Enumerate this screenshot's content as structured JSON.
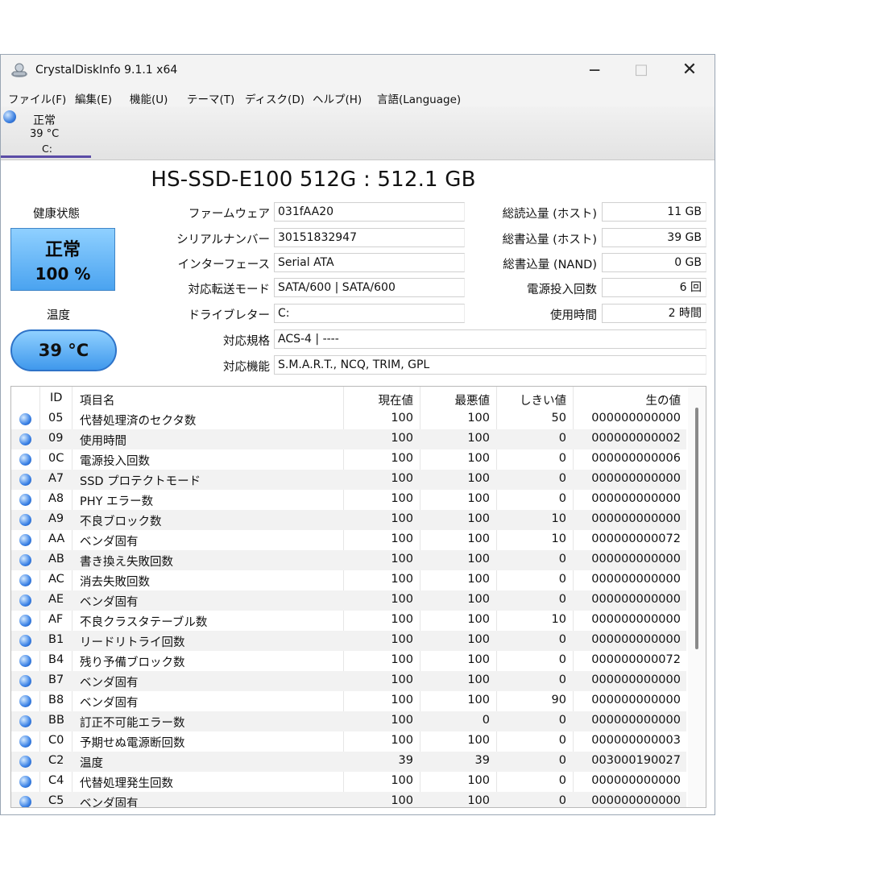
{
  "window": {
    "title": "CrystalDiskInfo 9.1.1 x64",
    "minimize_glyph": "─",
    "maximize_glyph": "□",
    "close_glyph": "✕"
  },
  "menu": [
    "ファイル(F)",
    "編集(E)",
    "機能(U)",
    "テーマ(T)",
    "ディスク(D)",
    "ヘルプ(H)",
    "言語(Language)"
  ],
  "drive_tab": {
    "status": "正常",
    "temperature": "39 °C",
    "letter": "C:"
  },
  "drive_title": "HS-SSD-E100 512G : 512.1 GB",
  "health": {
    "label": "健康状態",
    "status": "正常",
    "percent": "100 %"
  },
  "temperature": {
    "label": "温度",
    "value": "39 °C"
  },
  "fields": {
    "firmware": {
      "label": "ファームウェア",
      "value": "031fAA20"
    },
    "serial": {
      "label": "シリアルナンバー",
      "value": "30151832947"
    },
    "interface": {
      "label": "インターフェース",
      "value": "Serial ATA"
    },
    "transfer_mode": {
      "label": "対応転送モード",
      "value": "SATA/600 | SATA/600"
    },
    "drive_letter": {
      "label": "ドライブレター",
      "value": "C:"
    },
    "standard": {
      "label": "対応規格",
      "value": "ACS-4 | ----"
    },
    "features": {
      "label": "対応機能",
      "value": "S.M.A.R.T., NCQ, TRIM, GPL"
    },
    "host_reads": {
      "label": "総読込量 (ホスト)",
      "value": "11 GB"
    },
    "host_writes": {
      "label": "総書込量 (ホスト)",
      "value": "39 GB"
    },
    "nand_writes": {
      "label": "総書込量 (NAND)",
      "value": "0 GB"
    },
    "power_on_count": {
      "label": "電源投入回数",
      "value": "6 回"
    },
    "power_on_hours": {
      "label": "使用時間",
      "value": "2 時間"
    }
  },
  "smart": {
    "headers": {
      "id": "ID",
      "name": "項目名",
      "current": "現在値",
      "worst": "最悪値",
      "threshold": "しきい値",
      "raw": "生の値"
    },
    "rows": [
      {
        "id": "05",
        "name": "代替処理済のセクタ数",
        "current": "100",
        "worst": "100",
        "threshold": "50",
        "raw": "000000000000"
      },
      {
        "id": "09",
        "name": "使用時間",
        "current": "100",
        "worst": "100",
        "threshold": "0",
        "raw": "000000000002"
      },
      {
        "id": "0C",
        "name": "電源投入回数",
        "current": "100",
        "worst": "100",
        "threshold": "0",
        "raw": "000000000006"
      },
      {
        "id": "A7",
        "name": "SSD プロテクトモード",
        "current": "100",
        "worst": "100",
        "threshold": "0",
        "raw": "000000000000"
      },
      {
        "id": "A8",
        "name": "PHY エラー数",
        "current": "100",
        "worst": "100",
        "threshold": "0",
        "raw": "000000000000"
      },
      {
        "id": "A9",
        "name": "不良ブロック数",
        "current": "100",
        "worst": "100",
        "threshold": "10",
        "raw": "000000000000"
      },
      {
        "id": "AA",
        "name": "ベンダ固有",
        "current": "100",
        "worst": "100",
        "threshold": "10",
        "raw": "000000000072"
      },
      {
        "id": "AB",
        "name": "書き換え失敗回数",
        "current": "100",
        "worst": "100",
        "threshold": "0",
        "raw": "000000000000"
      },
      {
        "id": "AC",
        "name": "消去失敗回数",
        "current": "100",
        "worst": "100",
        "threshold": "0",
        "raw": "000000000000"
      },
      {
        "id": "AE",
        "name": "ベンダ固有",
        "current": "100",
        "worst": "100",
        "threshold": "0",
        "raw": "000000000000"
      },
      {
        "id": "AF",
        "name": "不良クラスタテーブル数",
        "current": "100",
        "worst": "100",
        "threshold": "10",
        "raw": "000000000000"
      },
      {
        "id": "B1",
        "name": "リードリトライ回数",
        "current": "100",
        "worst": "100",
        "threshold": "0",
        "raw": "000000000000"
      },
      {
        "id": "B4",
        "name": "残り予備ブロック数",
        "current": "100",
        "worst": "100",
        "threshold": "0",
        "raw": "000000000072"
      },
      {
        "id": "B7",
        "name": "ベンダ固有",
        "current": "100",
        "worst": "100",
        "threshold": "0",
        "raw": "000000000000"
      },
      {
        "id": "B8",
        "name": "ベンダ固有",
        "current": "100",
        "worst": "100",
        "threshold": "90",
        "raw": "000000000000"
      },
      {
        "id": "BB",
        "name": "訂正不可能エラー数",
        "current": "100",
        "worst": "0",
        "threshold": "0",
        "raw": "000000000000"
      },
      {
        "id": "C0",
        "name": "予期せぬ電源断回数",
        "current": "100",
        "worst": "100",
        "threshold": "0",
        "raw": "000000000003"
      },
      {
        "id": "C2",
        "name": "温度",
        "current": "39",
        "worst": "39",
        "threshold": "0",
        "raw": "003000190027"
      },
      {
        "id": "C4",
        "name": "代替処理発生回数",
        "current": "100",
        "worst": "100",
        "threshold": "0",
        "raw": "000000000000"
      },
      {
        "id": "C5",
        "name": "ベンダ固有",
        "current": "100",
        "worst": "100",
        "threshold": "0",
        "raw": "000000000000"
      }
    ]
  }
}
